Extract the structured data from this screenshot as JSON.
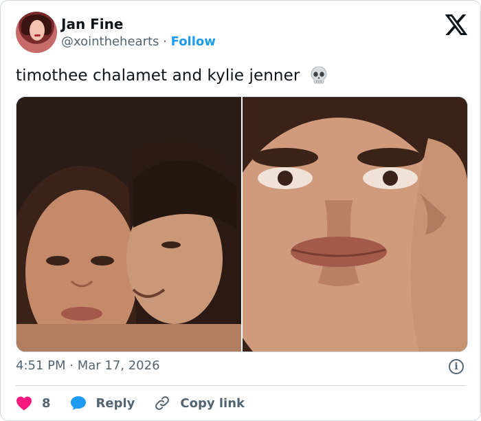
{
  "author": {
    "name": "Jan Fine",
    "handle": "@xointhehearts",
    "separator": "·",
    "follow_label": "Follow"
  },
  "tweet": {
    "text": "timothee chalamet and kylie jenner",
    "emoji": "skull-icon",
    "timestamp": "4:51 PM · Mar 17, 2026"
  },
  "actions": {
    "likes": "8",
    "reply_label": "Reply",
    "copy_label": "Copy link"
  },
  "colors": {
    "accent": "#1d9bf0",
    "like": "#f91880",
    "muted": "#536471",
    "text": "#0f1419",
    "border": "#cfd9de"
  }
}
